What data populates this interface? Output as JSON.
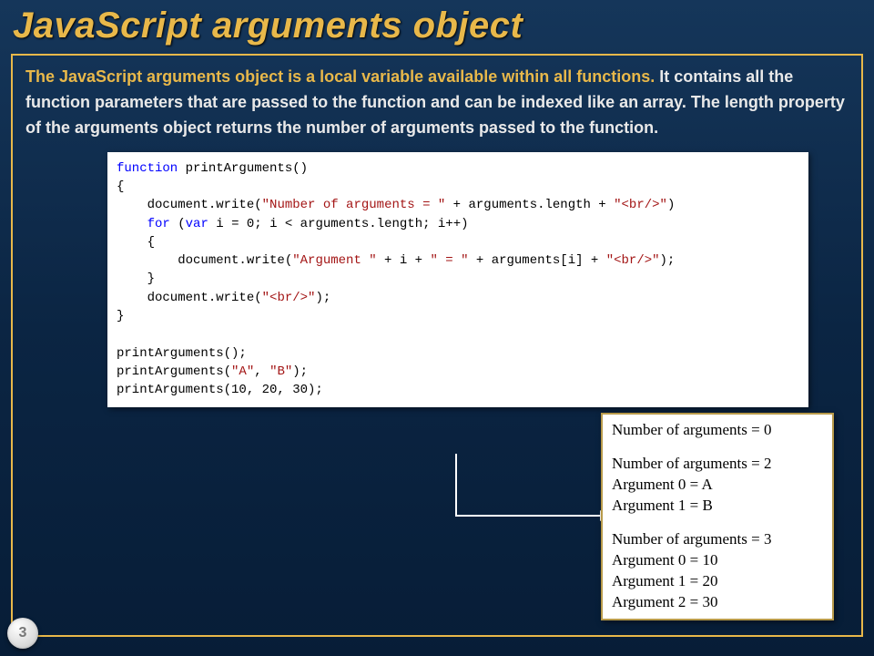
{
  "title": "JavaScript arguments object",
  "intro": {
    "highlight": "The JavaScript arguments object is a local variable available within all functions.",
    "rest": " It contains all the function parameters that are passed to the function and can be indexed like an array. The length property of the arguments object returns the number of arguments passed to the function."
  },
  "code": {
    "l1a": "function",
    "l1b": " printArguments()",
    "l2": "{",
    "l3a": "    document.write(",
    "l3b": "\"Number of arguments = \"",
    "l3c": " + arguments.length + ",
    "l3d": "\"<br/>\"",
    "l3e": ")",
    "l4a": "    ",
    "l4b": "for",
    "l4c": " (",
    "l4d": "var",
    "l4e": " i = 0; i < arguments.length; i++)",
    "l5": "    {",
    "l6a": "        document.write(",
    "l6b": "\"Argument \"",
    "l6c": " + i + ",
    "l6d": "\" = \"",
    "l6e": " + arguments[i] + ",
    "l6f": "\"<br/>\"",
    "l6g": ");",
    "l7": "    }",
    "l8a": "    document.write(",
    "l8b": "\"<br/>\"",
    "l8c": ");",
    "l9": "}",
    "l10": "",
    "l11": "printArguments();",
    "l12a": "printArguments(",
    "l12b": "\"A\"",
    "l12c": ", ",
    "l12d": "\"B\"",
    "l12e": ");",
    "l13": "printArguments(10, 20, 30);"
  },
  "output": {
    "g1_l1": "Number of arguments = 0",
    "g2_l1": "Number of arguments = 2",
    "g2_l2": "Argument 0 = A",
    "g2_l3": "Argument 1 = B",
    "g3_l1": "Number of arguments = 3",
    "g3_l2": "Argument 0 = 10",
    "g3_l3": "Argument 1 = 20",
    "g3_l4": "Argument 2 = 30"
  },
  "page_number": "3"
}
